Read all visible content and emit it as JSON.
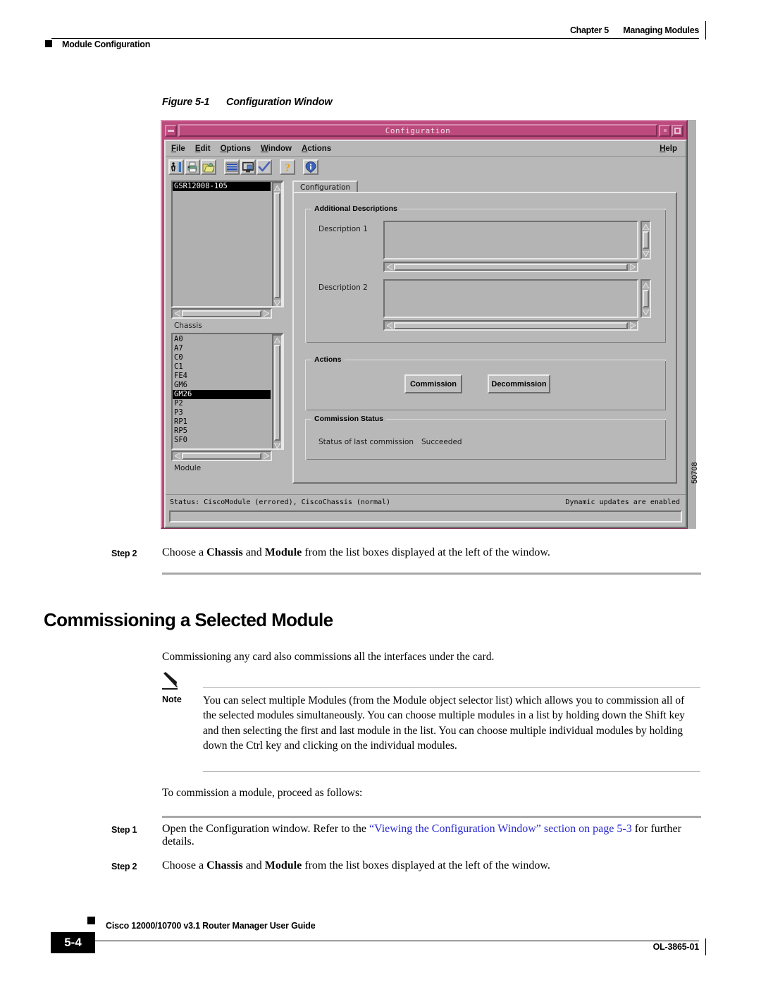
{
  "header": {
    "chapter": "Chapter 5",
    "chapter_title": "Managing Modules",
    "section": "Module Configuration"
  },
  "figure": {
    "label": "Figure 5-1",
    "title": "Configuration Window",
    "figure_number": "50708"
  },
  "window": {
    "title": "Configuration",
    "menus": [
      "File",
      "Edit",
      "Options",
      "Window",
      "Actions"
    ],
    "help_menu": "Help",
    "toolbar_icons": [
      "exit-icon",
      "print-icon",
      "open-folder-icon",
      "list-icon",
      "monitor-icon",
      "check-icon",
      "help-question-icon",
      "info-icon"
    ],
    "window_buttons": [
      "minimize-button",
      "maximize-button"
    ],
    "chassis_selector": {
      "items": [
        "GSR12008-105"
      ],
      "selected": "GSR12008-105",
      "label": "Chassis"
    },
    "module_selector": {
      "items": [
        "A0",
        "A7",
        "C0",
        "C1",
        "FE4",
        "GM6",
        "GM26",
        "P2",
        "P3",
        "RP1",
        "RP5",
        "SF0"
      ],
      "selected": "GM26",
      "label": "Module"
    },
    "tab": "Configuration",
    "additional_descriptions": {
      "group_title": "Additional Descriptions",
      "fields": [
        {
          "label": "Description 1",
          "value": ""
        },
        {
          "label": "Description 2",
          "value": ""
        }
      ]
    },
    "actions": {
      "group_title": "Actions",
      "commission_label": "Commission",
      "decommission_label": "Decommission"
    },
    "commission_status": {
      "group_title": "Commission Status",
      "label": "Status of last commission",
      "value": "Succeeded"
    },
    "statusbar": {
      "left": "Status: CiscoModule (errored), CiscoChassis (normal)",
      "right": "Dynamic updates are enabled",
      "message_field": ""
    },
    "colors": {
      "titlebar": "#bc4a7c",
      "titlebar_light": "#d98bb0",
      "titlebar_dark": "#7d2d52",
      "face": "#b8b8b8",
      "selection": "#000000"
    }
  },
  "body": {
    "step2_top_label": "Step 2",
    "step2_top_text_a": "Choose a ",
    "step2_top_bold1": "Chassis",
    "step2_top_text_b": " and ",
    "step2_top_bold2": "Module",
    "step2_top_text_c": " from the list boxes displayed at the left of the window.",
    "section_heading": "Commissioning a Selected Module",
    "intro": "Commissioning any card also commissions all the interfaces under the card.",
    "note_label": "Note",
    "note_text": "You can select multiple Modules (from the Module object selector list) which allows you to commission all of the selected modules simultaneously. You can choose multiple modules in a list by holding down the Shift key and then selecting the first and last module in the list. You can choose multiple individual modules by holding down the Ctrl key and clicking on the individual modules.",
    "lead_in": "To commission a module, proceed as follows:",
    "step1_label": "Step 1",
    "step1_text_a": "Open the Configuration window. Refer to the ",
    "step1_link": "“Viewing the Configuration Window” section on page 5-3",
    "step1_text_b": " for further details.",
    "step2_label": "Step 2",
    "step2_text_a": "Choose a ",
    "step2_bold1": "Chassis",
    "step2_text_b": " and ",
    "step2_bold2": "Module",
    "step2_text_c": " from the list boxes displayed at the left of the window."
  },
  "footer": {
    "page_number": "5-4",
    "guide_title": "Cisco 12000/10700 v3.1 Router Manager User Guide",
    "doc_number": "OL-3865-01"
  }
}
